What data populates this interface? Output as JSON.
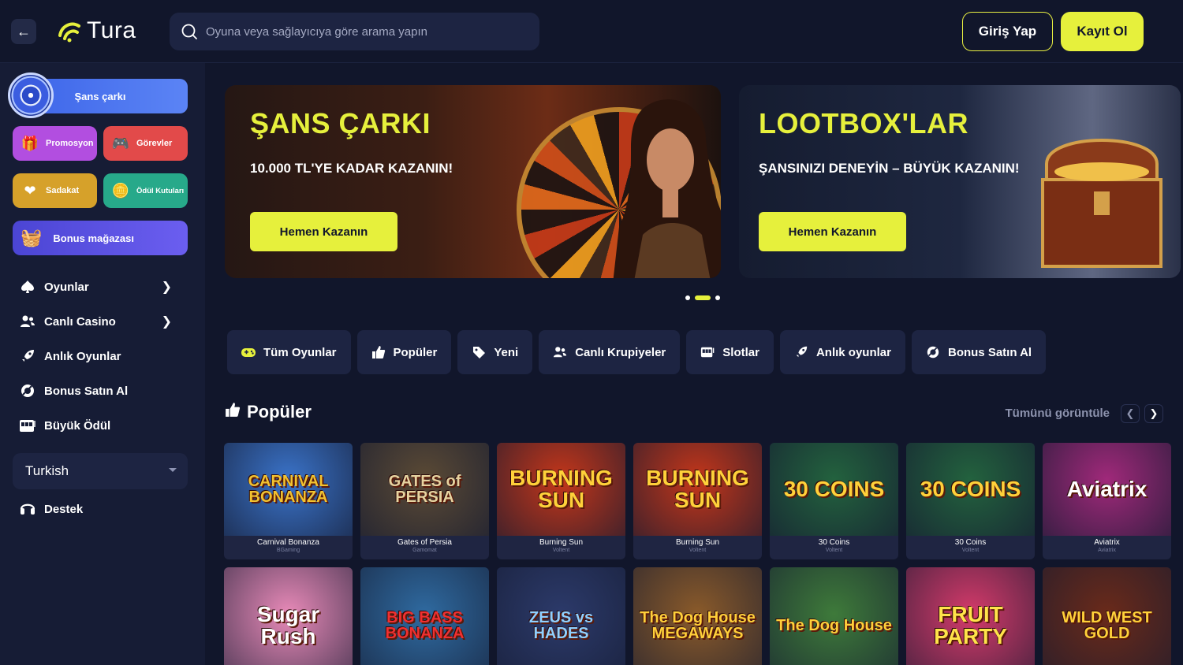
{
  "header": {
    "brand": "Tura",
    "search_placeholder": "Oyuna veya sağlayıcıya göre arama yapın",
    "login_label": "Giriş Yap",
    "register_label": "Kayıt Ol"
  },
  "sidebar": {
    "wheel_label": "Şans çarkı",
    "tiles": [
      {
        "label": "Promosyon",
        "icon": "gift-icon",
        "bg": "#b24ee0"
      },
      {
        "label": "Görevler",
        "icon": "gamepad-icon",
        "bg": "#e24a4a"
      },
      {
        "label": "Sadakat",
        "icon": "heart-icon",
        "bg": "#d6a12a"
      },
      {
        "label": "Ödül Kutuları",
        "icon": "coin-icon",
        "bg": "#27a98a"
      }
    ],
    "bonus_store_label": "Bonus mağazası",
    "nav": [
      {
        "label": "Oyunlar",
        "has_children": true
      },
      {
        "label": "Canlı Casino",
        "has_children": true
      },
      {
        "label": "Anlık Oyunlar",
        "has_children": false
      },
      {
        "label": "Bonus Satın Al",
        "has_children": false
      },
      {
        "label": "Büyük Ödül",
        "has_children": false
      }
    ],
    "language": "Turkish",
    "support_label": "Destek"
  },
  "banners": [
    {
      "title": "ŞANS ÇARKI",
      "subtitle": "10.000 TL'YE KADAR KAZANIN!",
      "cta": "Hemen Kazanın"
    },
    {
      "title": "LOOTBOX'LAR",
      "subtitle": "ŞANSINIZI DENEYİN – BÜYÜK KAZANIN!",
      "cta": "Hemen Kazanın"
    }
  ],
  "carousel": {
    "total": 3,
    "active": 1
  },
  "tabs": [
    "Tüm Oyunlar",
    "Popüler",
    "Yeni",
    "Canlı Krupiyeler",
    "Slotlar",
    "Anlık oyunlar",
    "Bonus Satın Al"
  ],
  "popular": {
    "title": "Popüler",
    "see_all": "Tümünü görüntüle",
    "games_row1": [
      {
        "name": "Carnival Bonanza",
        "provider": "BGaming",
        "art": "CARNIVAL BONANZA",
        "bg": "#3a73c9",
        "fg": "#f2c230"
      },
      {
        "name": "Gates of Persia",
        "provider": "Gamomat",
        "art": "GATES of PERSIA",
        "bg": "#5b4a35",
        "fg": "#e6d3a0"
      },
      {
        "name": "Burning Sun",
        "provider": "Voltent",
        "art": "BURNING SUN",
        "bg": "#c4361a",
        "fg": "#ffd13a"
      },
      {
        "name": "Burning Sun",
        "provider": "Voltent",
        "art": "BURNING SUN",
        "bg": "#c4361a",
        "fg": "#ffd13a"
      },
      {
        "name": "30 Coins",
        "provider": "Voltent",
        "art": "30 COINS",
        "bg": "#23623e",
        "fg": "#ffd13a"
      },
      {
        "name": "30 Coins",
        "provider": "Voltent",
        "art": "30 COINS",
        "bg": "#23623e",
        "fg": "#ffd13a"
      },
      {
        "name": "Aviatrix",
        "provider": "Aviatrix",
        "art": "Aviatrix",
        "bg": "#a0297a",
        "fg": "#ffffff"
      }
    ],
    "games_row2": [
      {
        "art": "Sugar Rush",
        "bg": "#e88ab8",
        "fg": "#ffffff"
      },
      {
        "art": "BIG BASS BONANZA",
        "bg": "#2f6aa0",
        "fg": "#f03030"
      },
      {
        "art": "ZEUS vs HADES",
        "bg": "#2c3a6a",
        "fg": "#8fd0ff"
      },
      {
        "art": "The Dog House MEGAWAYS",
        "bg": "#8a5a2a",
        "fg": "#ffcf3a"
      },
      {
        "art": "The Dog House",
        "bg": "#3e7a3a",
        "fg": "#ffcf3a"
      },
      {
        "art": "FRUIT PARTY",
        "bg": "#d43a6a",
        "fg": "#ffe34a"
      },
      {
        "art": "WILD WEST GOLD",
        "bg": "#6a2a1a",
        "fg": "#ffd13a"
      }
    ]
  }
}
